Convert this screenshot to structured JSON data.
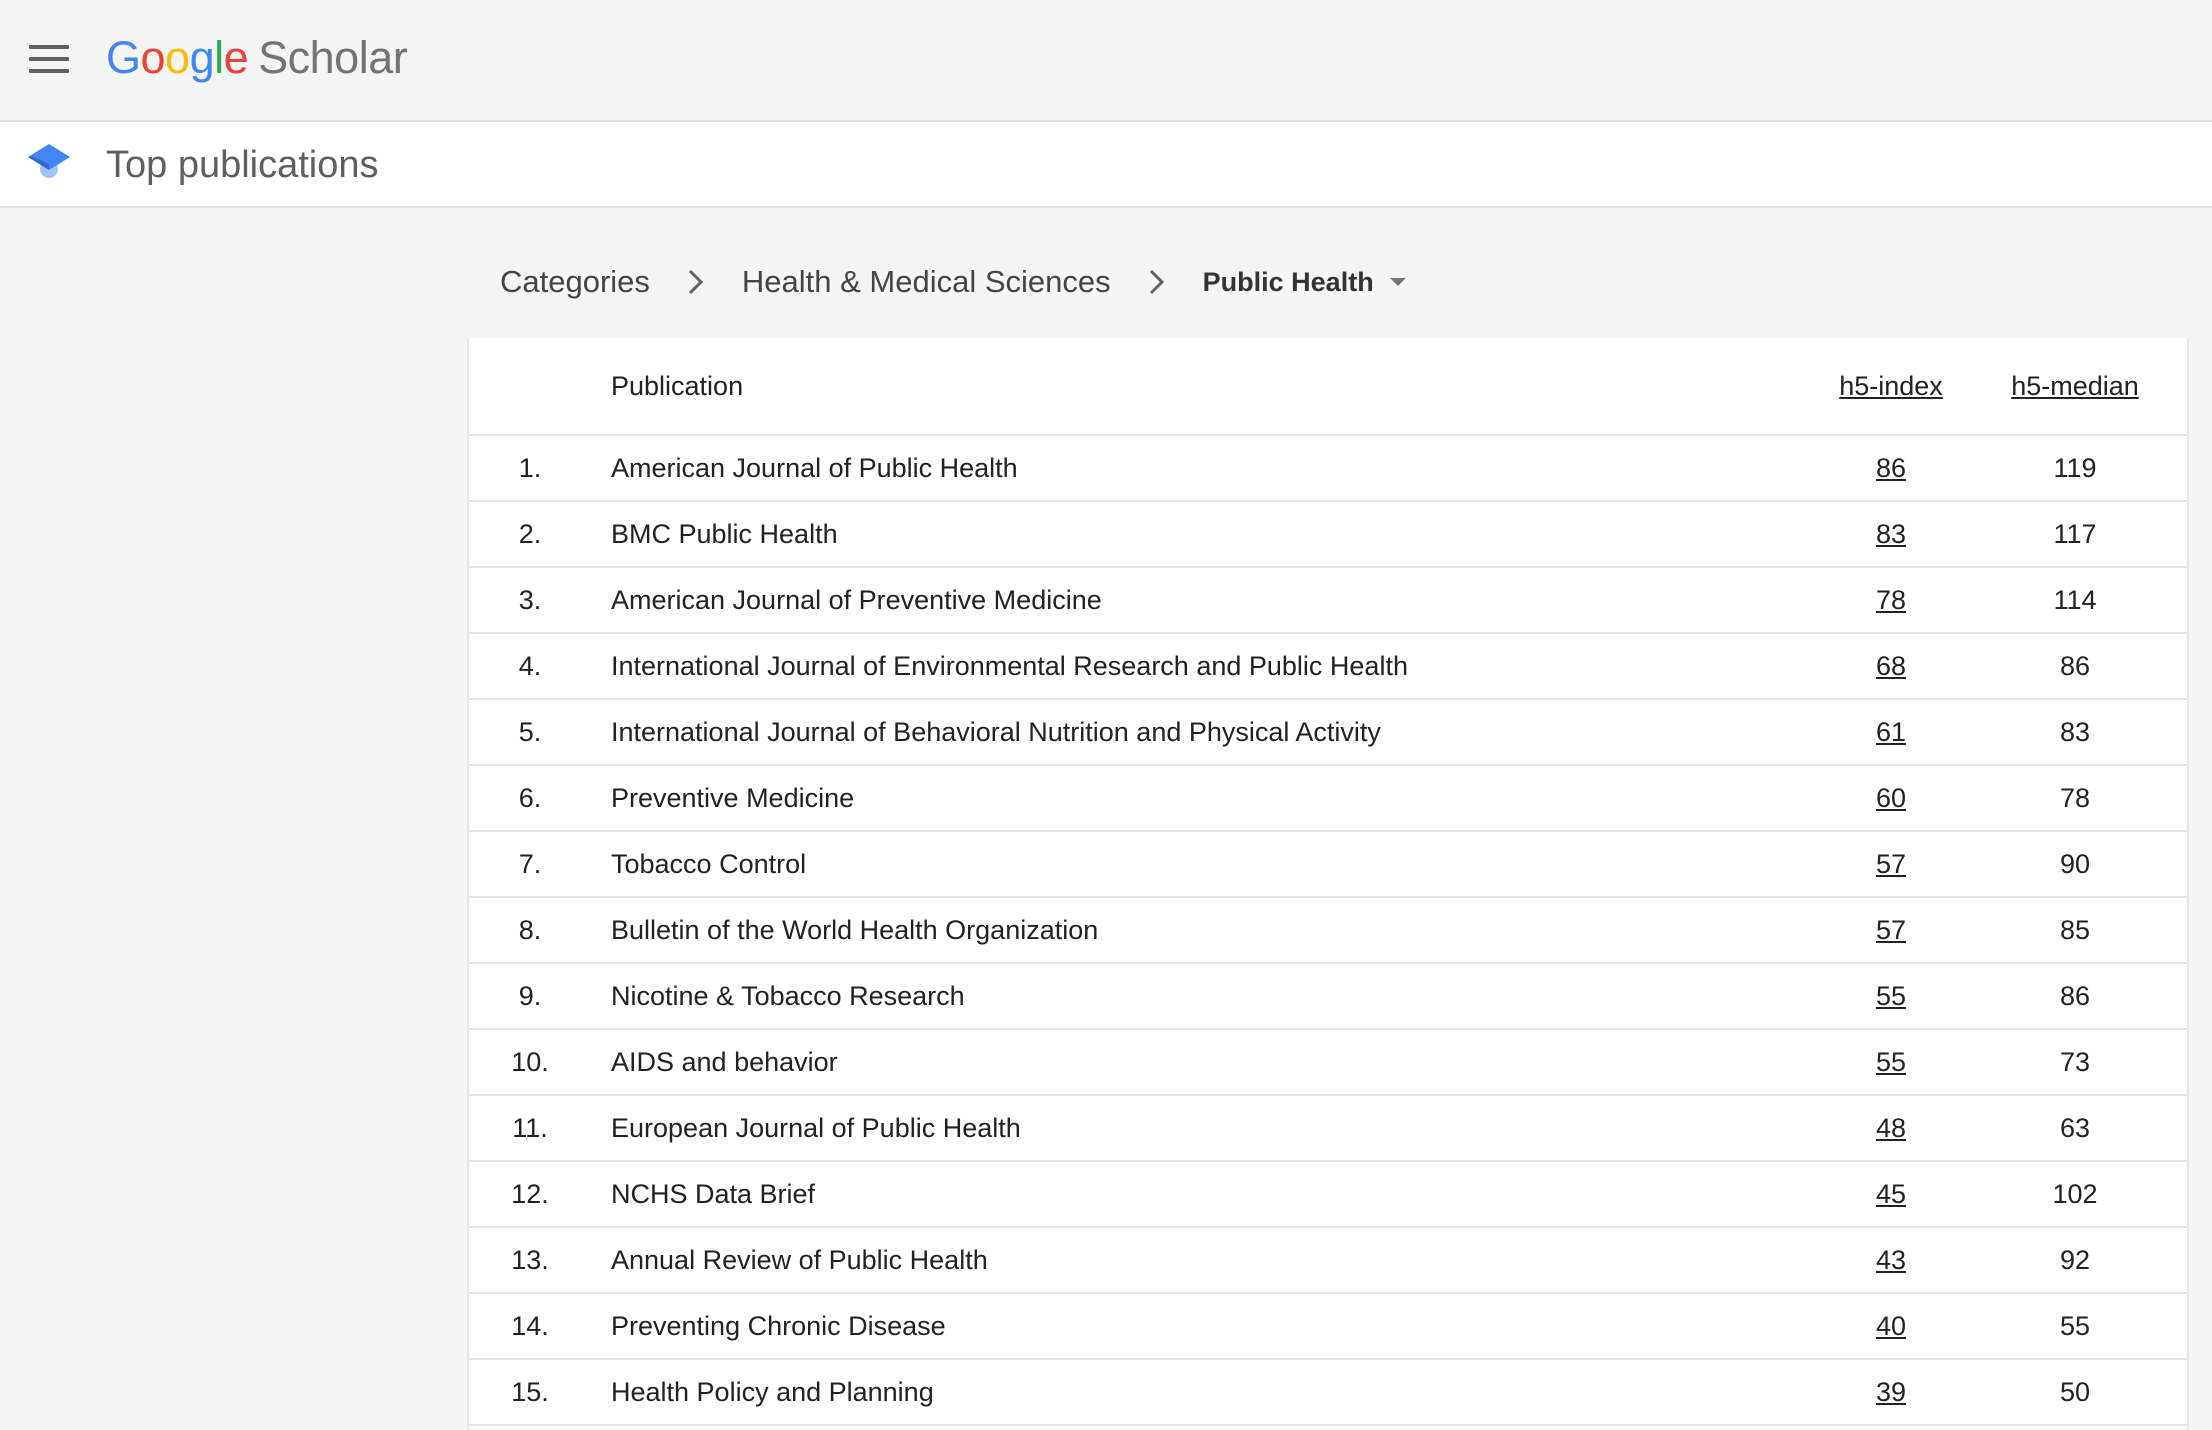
{
  "header": {
    "logo": {
      "letters": [
        "G",
        "o",
        "o",
        "g",
        "l",
        "e"
      ],
      "product": "Scholar"
    },
    "page_title": "Top publications"
  },
  "breadcrumb": {
    "items": [
      "Categories",
      "Health & Medical Sciences"
    ],
    "current": "Public Health"
  },
  "table": {
    "columns": {
      "publication": "Publication",
      "h5_index": "h5-index",
      "h5_median": "h5-median"
    },
    "rows": [
      {
        "rank": "1.",
        "publication": "American Journal of Public Health",
        "h5_index": "86",
        "h5_median": "119"
      },
      {
        "rank": "2.",
        "publication": "BMC Public Health",
        "h5_index": "83",
        "h5_median": "117"
      },
      {
        "rank": "3.",
        "publication": "American Journal of Preventive Medicine",
        "h5_index": "78",
        "h5_median": "114"
      },
      {
        "rank": "4.",
        "publication": "International Journal of Environmental Research and Public Health",
        "h5_index": "68",
        "h5_median": "86"
      },
      {
        "rank": "5.",
        "publication": "International Journal of Behavioral Nutrition and Physical Activity",
        "h5_index": "61",
        "h5_median": "83"
      },
      {
        "rank": "6.",
        "publication": "Preventive Medicine",
        "h5_index": "60",
        "h5_median": "78"
      },
      {
        "rank": "7.",
        "publication": "Tobacco Control",
        "h5_index": "57",
        "h5_median": "90"
      },
      {
        "rank": "8.",
        "publication": "Bulletin of the World Health Organization",
        "h5_index": "57",
        "h5_median": "85"
      },
      {
        "rank": "9.",
        "publication": "Nicotine & Tobacco Research",
        "h5_index": "55",
        "h5_median": "86"
      },
      {
        "rank": "10.",
        "publication": "AIDS and behavior",
        "h5_index": "55",
        "h5_median": "73"
      },
      {
        "rank": "11.",
        "publication": "European Journal of Public Health",
        "h5_index": "48",
        "h5_median": "63"
      },
      {
        "rank": "12.",
        "publication": "NCHS Data Brief",
        "h5_index": "45",
        "h5_median": "102"
      },
      {
        "rank": "13.",
        "publication": "Annual Review of Public Health",
        "h5_index": "43",
        "h5_median": "92"
      },
      {
        "rank": "14.",
        "publication": "Preventing Chronic Disease",
        "h5_index": "40",
        "h5_median": "55"
      },
      {
        "rank": "15.",
        "publication": "Health Policy and Planning",
        "h5_index": "39",
        "h5_median": "50"
      }
    ]
  },
  "icons": {
    "menu": "hamburger-menu-icon",
    "scholar": "graduation-cap-icon",
    "separator": "chevron-right-icon",
    "dropdown": "caret-down-icon"
  },
  "colors": {
    "google_blue": "#4285f4",
    "google_red": "#ea4335",
    "google_yellow": "#fbbc05",
    "google_green": "#34a853",
    "scholar_gray": "#737373"
  }
}
